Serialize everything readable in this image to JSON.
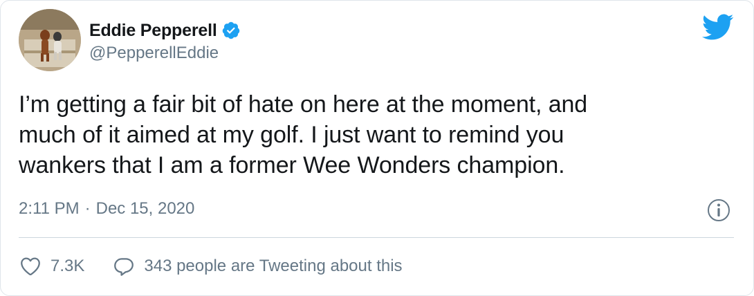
{
  "author": {
    "display_name": "Eddie Pepperell",
    "handle": "@PepperellEddie",
    "verified": true
  },
  "tweet": {
    "text_lines": [
      "I’m getting a fair bit of hate on here at the moment, and",
      "much of it aimed at my golf. I just want to remind you",
      "wankers that I am a former Wee Wonders champion."
    ],
    "time": "2:11 PM",
    "separator": "·",
    "date": "Dec 15, 2020"
  },
  "actions": {
    "like_count": "7.3K",
    "conversation_label": "343 people are Tweeting about this"
  },
  "icons": {
    "avatar": "avatar-photo",
    "verified": "verified-badge-icon",
    "brand": "twitter-bird-icon",
    "info": "info-icon",
    "like": "heart-icon",
    "reply": "speech-bubble-icon"
  },
  "colors": {
    "brand_blue": "#1da1f2",
    "text": "#14171a",
    "secondary": "#657786",
    "divider": "#ccd6dd"
  }
}
